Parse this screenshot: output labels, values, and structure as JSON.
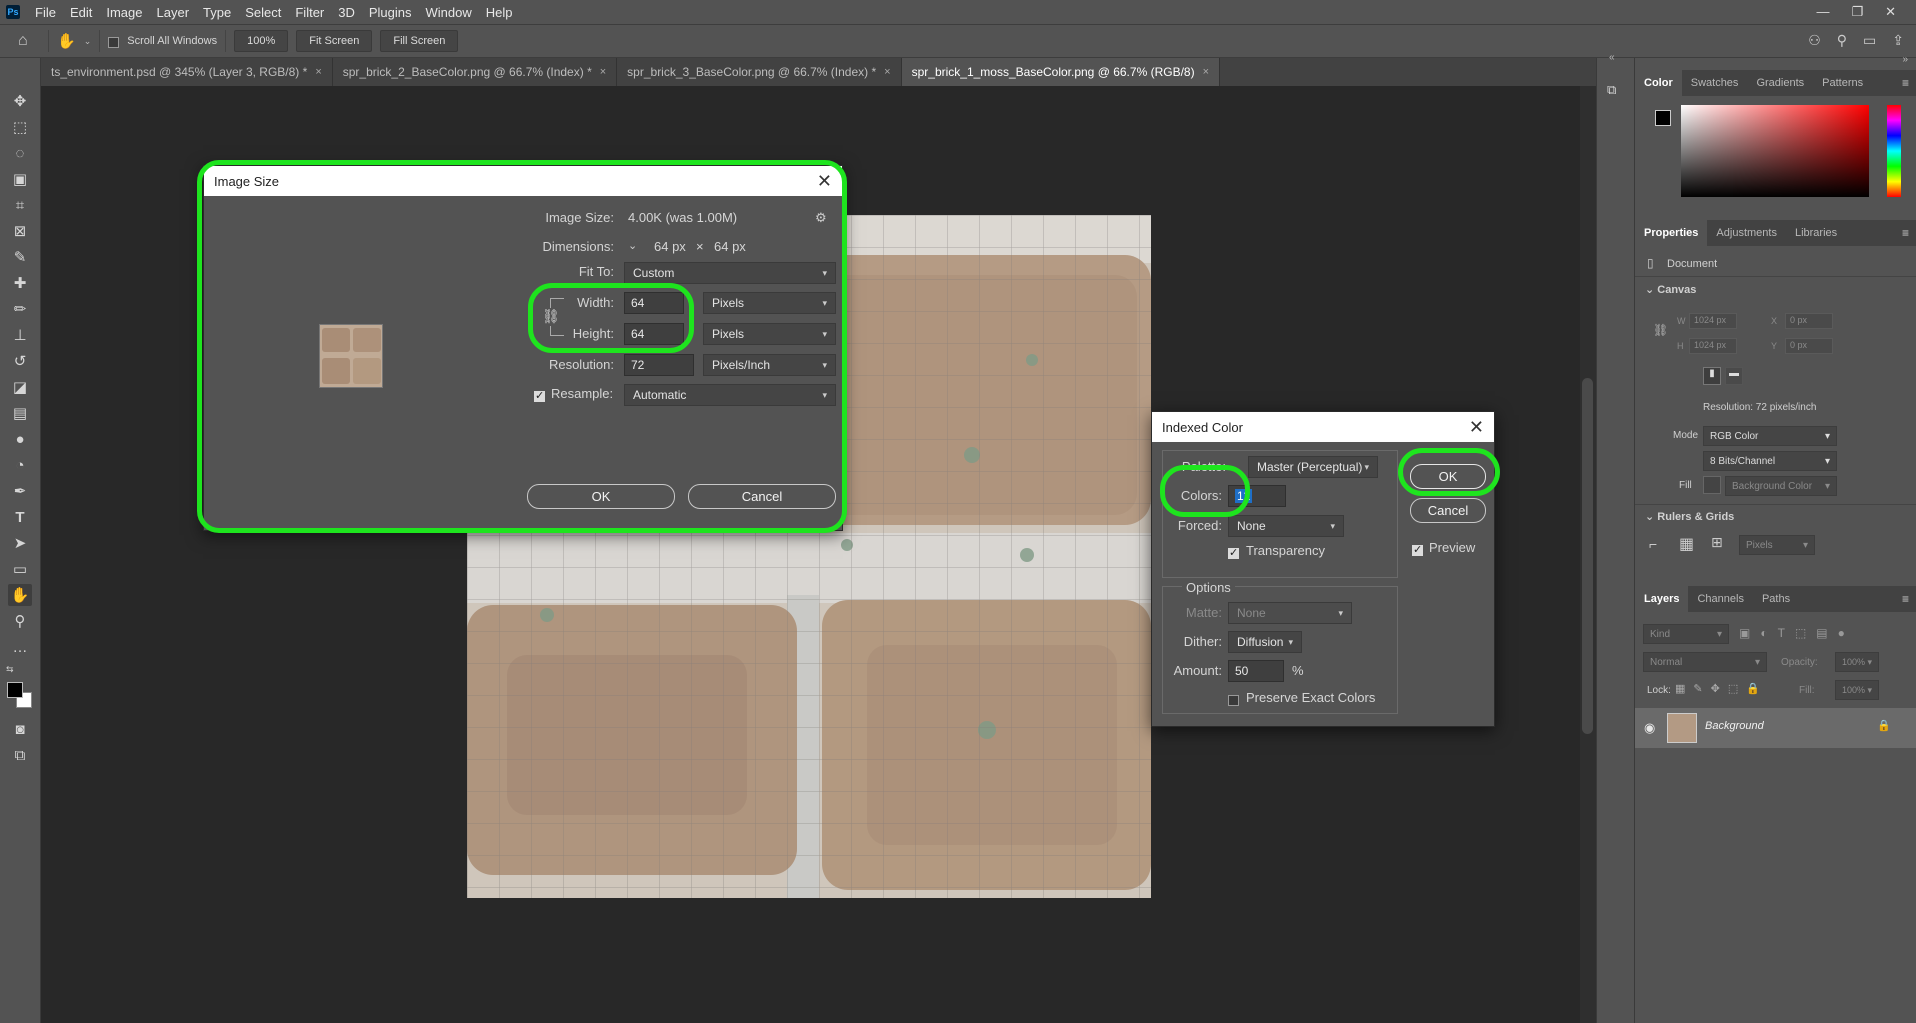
{
  "app": {
    "logo": "Ps"
  },
  "menu": [
    "File",
    "Edit",
    "Image",
    "Layer",
    "Type",
    "Select",
    "Filter",
    "3D",
    "Plugins",
    "Window",
    "Help"
  ],
  "window_controls": {
    "minimize": "—",
    "restore": "❐",
    "close": "✕"
  },
  "options_bar": {
    "scroll_all_label": "Scroll All Windows",
    "zoom_label": "100%",
    "fit_screen": "Fit Screen",
    "fill_screen": "Fill Screen"
  },
  "tabs": [
    {
      "label": "ts_environment.psd @ 345% (Layer 3, RGB/8) *"
    },
    {
      "label": "spr_brick_2_BaseColor.png @ 66.7% (Index) *"
    },
    {
      "label": "spr_brick_3_BaseColor.png @ 66.7% (Index) *"
    },
    {
      "label": "spr_brick_1_moss_BaseColor.png @ 66.7% (RGB/8)"
    }
  ],
  "tab_close": "×",
  "color_panel": {
    "tabs": [
      "Color",
      "Swatches",
      "Gradients",
      "Patterns"
    ]
  },
  "properties_panel": {
    "tabs": [
      "Properties",
      "Adjustments",
      "Libraries"
    ],
    "document_label": "Document",
    "canvas_label": "Canvas",
    "w_label": "W",
    "w_value": "1024 px",
    "x_label": "X",
    "x_value": "0 px",
    "h_label": "H",
    "h_value": "1024 px",
    "y_label": "Y",
    "y_value": "0 px",
    "resolution": "Resolution: 72 pixels/inch",
    "mode_label": "Mode",
    "mode_value": "RGB Color",
    "bits_value": "8 Bits/Channel",
    "fill_label": "Fill",
    "fill_value": "Background Color",
    "rulers_label": "Rulers & Grids",
    "units_value": "Pixels"
  },
  "layers_panel": {
    "tabs": [
      "Layers",
      "Channels",
      "Paths"
    ],
    "kind_label": "Kind",
    "blend_mode": "Normal",
    "opacity_label": "Opacity:",
    "opacity_value": "100%",
    "lock_label": "Lock:",
    "fill_label": "Fill:",
    "fill_value": "100%",
    "layer_name": "Background"
  },
  "image_size_dialog": {
    "title": "Image Size",
    "image_size_label": "Image Size:",
    "image_size_value": "4.00K (was 1.00M)",
    "dimensions_label": "Dimensions:",
    "dim_w": "64 px",
    "dim_x": "×",
    "dim_h": "64 px",
    "fit_to_label": "Fit To:",
    "fit_to_value": "Custom",
    "width_label": "Width:",
    "width_value": "64",
    "width_unit": "Pixels",
    "height_label": "Height:",
    "height_value": "64",
    "height_unit": "Pixels",
    "resolution_label": "Resolution:",
    "resolution_value": "72",
    "resolution_unit": "Pixels/Inch",
    "resample_label": "Resample:",
    "resample_value": "Automatic",
    "resample_checked": true,
    "ok_label": "OK",
    "cancel_label": "Cancel"
  },
  "indexed_color_dialog": {
    "title": "Indexed Color",
    "palette_label": "Palette:",
    "palette_value": "Master (Perceptual)",
    "colors_label": "Colors:",
    "colors_value": "12",
    "forced_label": "Forced:",
    "forced_value": "None",
    "transparency_label": "Transparency",
    "transparency_checked": true,
    "options_label": "Options",
    "matte_label": "Matte:",
    "matte_value": "None",
    "dither_label": "Dither:",
    "dither_value": "Diffusion",
    "amount_label": "Amount:",
    "amount_value": "50",
    "amount_unit": "%",
    "preserve_label": "Preserve Exact Colors",
    "preserve_checked": false,
    "preview_label": "Preview",
    "preview_checked": true,
    "ok_label": "OK",
    "cancel_label": "Cancel"
  },
  "colors": {
    "highlight": "#1ee41e",
    "accent": "#31a8ff"
  }
}
